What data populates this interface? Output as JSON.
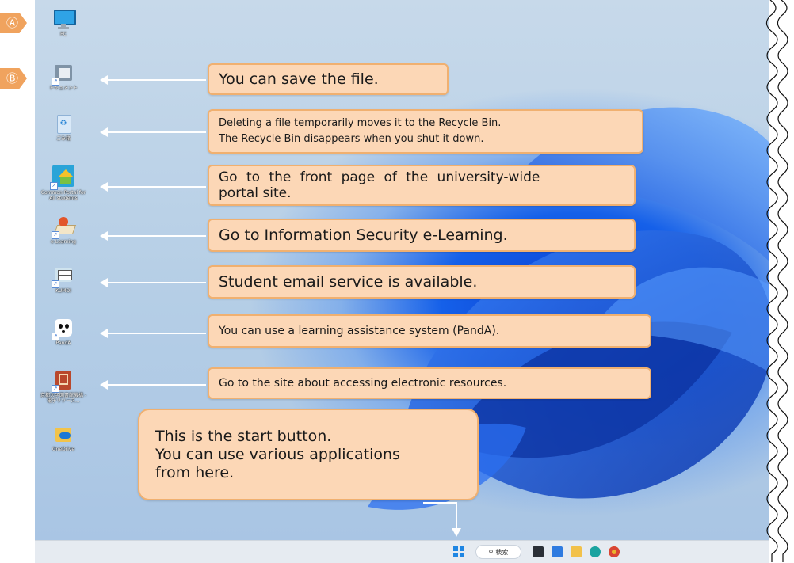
{
  "badges": [
    "Ⓐ",
    "Ⓑ"
  ],
  "desktop_icons": [
    {
      "caption": "PC",
      "icon": "monitor-icon"
    },
    {
      "caption": "ドキュメント",
      "icon": "documents-folder-icon"
    },
    {
      "caption": "ごみ箱",
      "icon": "recycle-bin-icon"
    },
    {
      "caption": "Common Portal for All students",
      "icon": "portal-house-icon"
    },
    {
      "caption": "e-Learning",
      "icon": "elearning-icon"
    },
    {
      "caption": "KUMOI",
      "icon": "mail-icon"
    },
    {
      "caption": "PandA",
      "icon": "panda-icon"
    },
    {
      "caption": "京都大学図書館機構 - 電子リソース...",
      "icon": "library-icon"
    },
    {
      "caption": "OneDrive",
      "icon": "onedrive-folder-icon"
    }
  ],
  "callouts": {
    "save_file": "You can save the file.",
    "recycle_bin": [
      "Deleting a file temporarily moves it to the Recycle Bin.",
      "The Recycle Bin disappears when you shut it down."
    ],
    "portal": [
      "Go to the front page of the university-wide",
      "portal site."
    ],
    "elearning": "Go to Information Security e-Learning.",
    "email": "Student email service is available.",
    "panda": "You can use a learning assistance system (PandA).",
    "e_resources": "Go to the site about accessing electronic resources.",
    "start": [
      "This is the start button.",
      "You can use various applications",
      "from here."
    ]
  },
  "taskbar": {
    "search_label": "検索",
    "items": [
      "start-button",
      "search-box",
      "task-view-icon",
      "widgets-icon",
      "file-explorer-icon",
      "edge-icon",
      "chrome-icon"
    ]
  },
  "colors": {
    "callout_fill": "#fcd7b6",
    "callout_border": "#f0b070",
    "badge": "#f0a35e",
    "wallpaper_blue": "#1560e9",
    "taskbar": "#e6ebf1"
  }
}
